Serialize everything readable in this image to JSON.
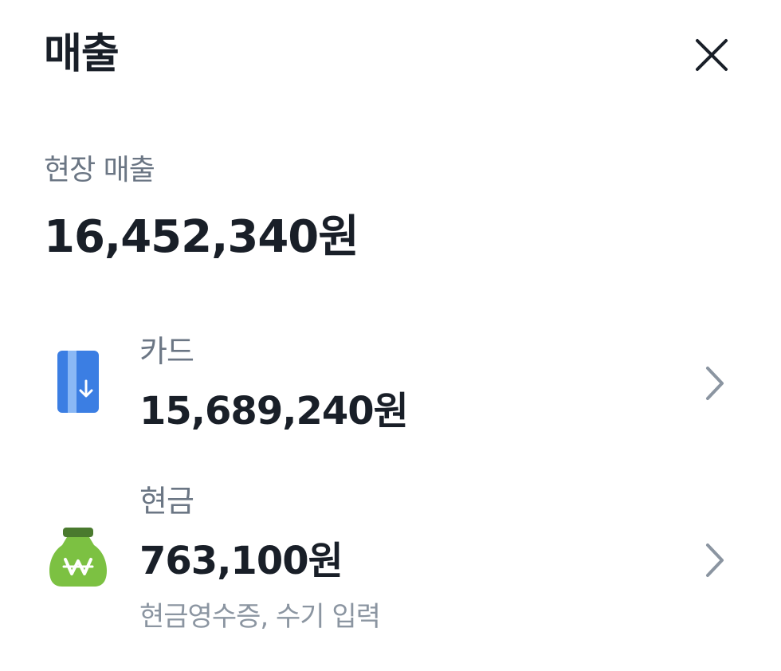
{
  "header": {
    "title": "매출",
    "close_icon": "close-icon"
  },
  "onsite_sales": {
    "label": "현장 매출",
    "total": "16,452,340원"
  },
  "payment_methods": [
    {
      "label": "카드",
      "amount": "15,689,240원",
      "icon": "card-icon",
      "icon_color": "#3b7ee3"
    },
    {
      "label": "현금",
      "amount": "763,100원",
      "sub": "현금영수증, 수기 입력",
      "icon": "cash-bag-icon",
      "icon_color": "#7cc142"
    }
  ],
  "colors": {
    "text_primary": "#191f28",
    "text_secondary": "#6b7684",
    "text_tertiary": "#8b95a1",
    "chevron": "#8b95a1"
  }
}
